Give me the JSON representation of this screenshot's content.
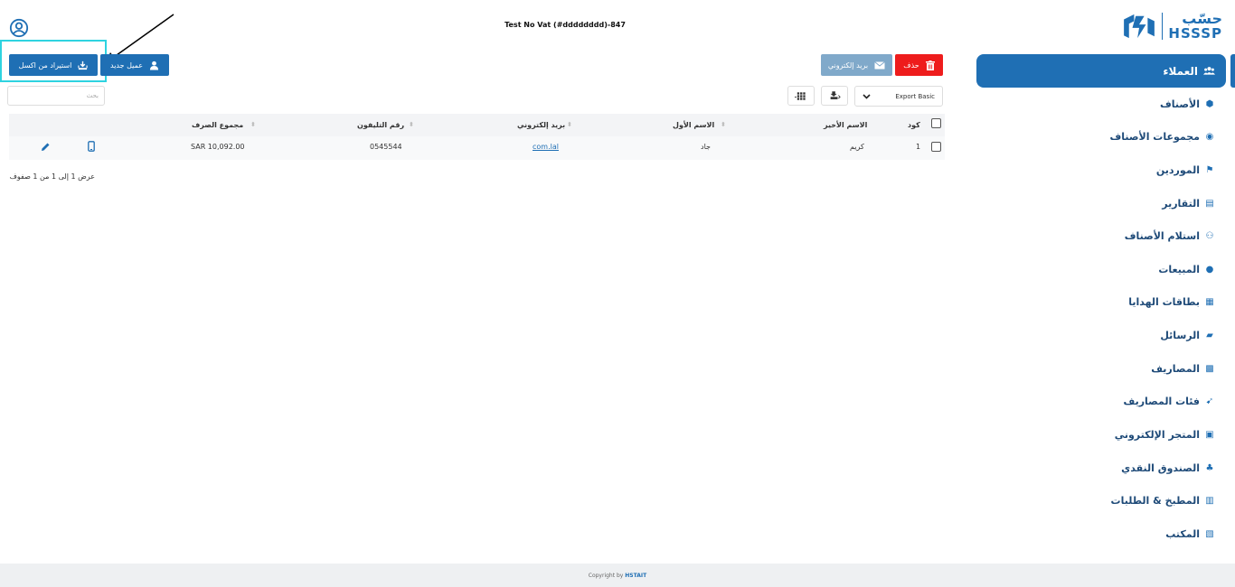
{
  "header": {
    "company": "Test No Vat (#dddddddd)-847"
  },
  "logo": {
    "arabic": "حسّب",
    "english": "HSSSP"
  },
  "sidebar": {
    "active": {
      "label": "العملاء",
      "icon": "users-icon"
    },
    "items": [
      {
        "label": "الأصناف",
        "icon": "box-icon"
      },
      {
        "label": "مجموعات الأصناف",
        "icon": "circle-grid-icon"
      },
      {
        "label": "الموردين",
        "icon": "supplier-icon"
      },
      {
        "label": "التقارير",
        "icon": "chart-icon"
      },
      {
        "label": "استلام الأصناف",
        "icon": "receive-icon"
      },
      {
        "label": "المبيعات",
        "icon": "sales-icon"
      },
      {
        "label": "بطاقات الهدايا",
        "icon": "gift-icon"
      },
      {
        "label": "الرسائل",
        "icon": "message-icon"
      },
      {
        "label": "المصاريف",
        "icon": "expenses-icon"
      },
      {
        "label": "فئات المصاريف",
        "icon": "expense-category-icon"
      },
      {
        "label": "المتجر الإلكتروني",
        "icon": "store-icon"
      },
      {
        "label": "الصندوق النقدي",
        "icon": "cash-box-icon"
      },
      {
        "label": "المطبخ & الطلبات",
        "icon": "kitchen-icon"
      },
      {
        "label": "المكتب",
        "icon": "office-icon"
      }
    ]
  },
  "toolbar": {
    "import_label": "استيراد من اكسل",
    "new_label": "عميل جديد",
    "email_label": "بريد إلكتروني",
    "delete_label": "حذف",
    "search_placeholder": "بحث",
    "export_value": "Export Basic"
  },
  "table": {
    "headers": {
      "code": "كود",
      "last_name": "الاسم الأخير",
      "first_name": "الاسم الأول",
      "email": "بريد إلكتروني",
      "phone": "رقم التليفون",
      "total": "مجموع الصرف"
    },
    "rows": [
      {
        "code": "1",
        "last_name": "كريم",
        "first_name": "جاد",
        "email": "com.lal",
        "phone": "0545544",
        "total": "SAR  10,092.00"
      }
    ],
    "info": "عرض 1 إلى 1 من 1 صفوف"
  },
  "footer": {
    "prefix": "Copyright by",
    "brand": "HSTAIT"
  },
  "colors": {
    "primary": "#1f6fb4",
    "danger": "#ee1c1c",
    "email": "#80a9ca",
    "highlight": "#2ed3e0"
  }
}
